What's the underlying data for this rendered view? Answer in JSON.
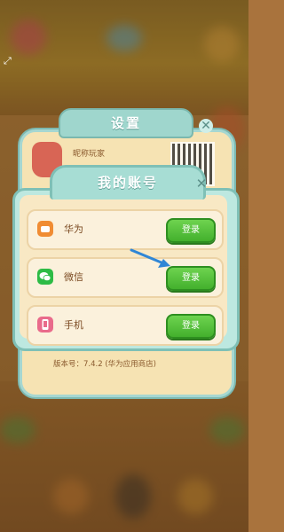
{
  "settings": {
    "title": "设置",
    "nickname": "昵称玩家",
    "version": "版本号：7.4.2 (华为应用商店)"
  },
  "account": {
    "title": "我的账号",
    "rows": [
      {
        "label": "华为",
        "button": "登录",
        "icon": "huawei-icon",
        "icon_color": "#f08c33"
      },
      {
        "label": "微信",
        "button": "登录",
        "icon": "wechat-icon",
        "icon_color": "#2dbb45"
      },
      {
        "label": "手机",
        "button": "登录",
        "icon": "phone-icon",
        "icon_color": "#e96b8b"
      }
    ]
  },
  "colors": {
    "panel_teal": "#a7ddd4",
    "panel_cream": "#f8e8c4",
    "login_green": "#43b02d",
    "arrow_blue": "#2f86d6"
  }
}
